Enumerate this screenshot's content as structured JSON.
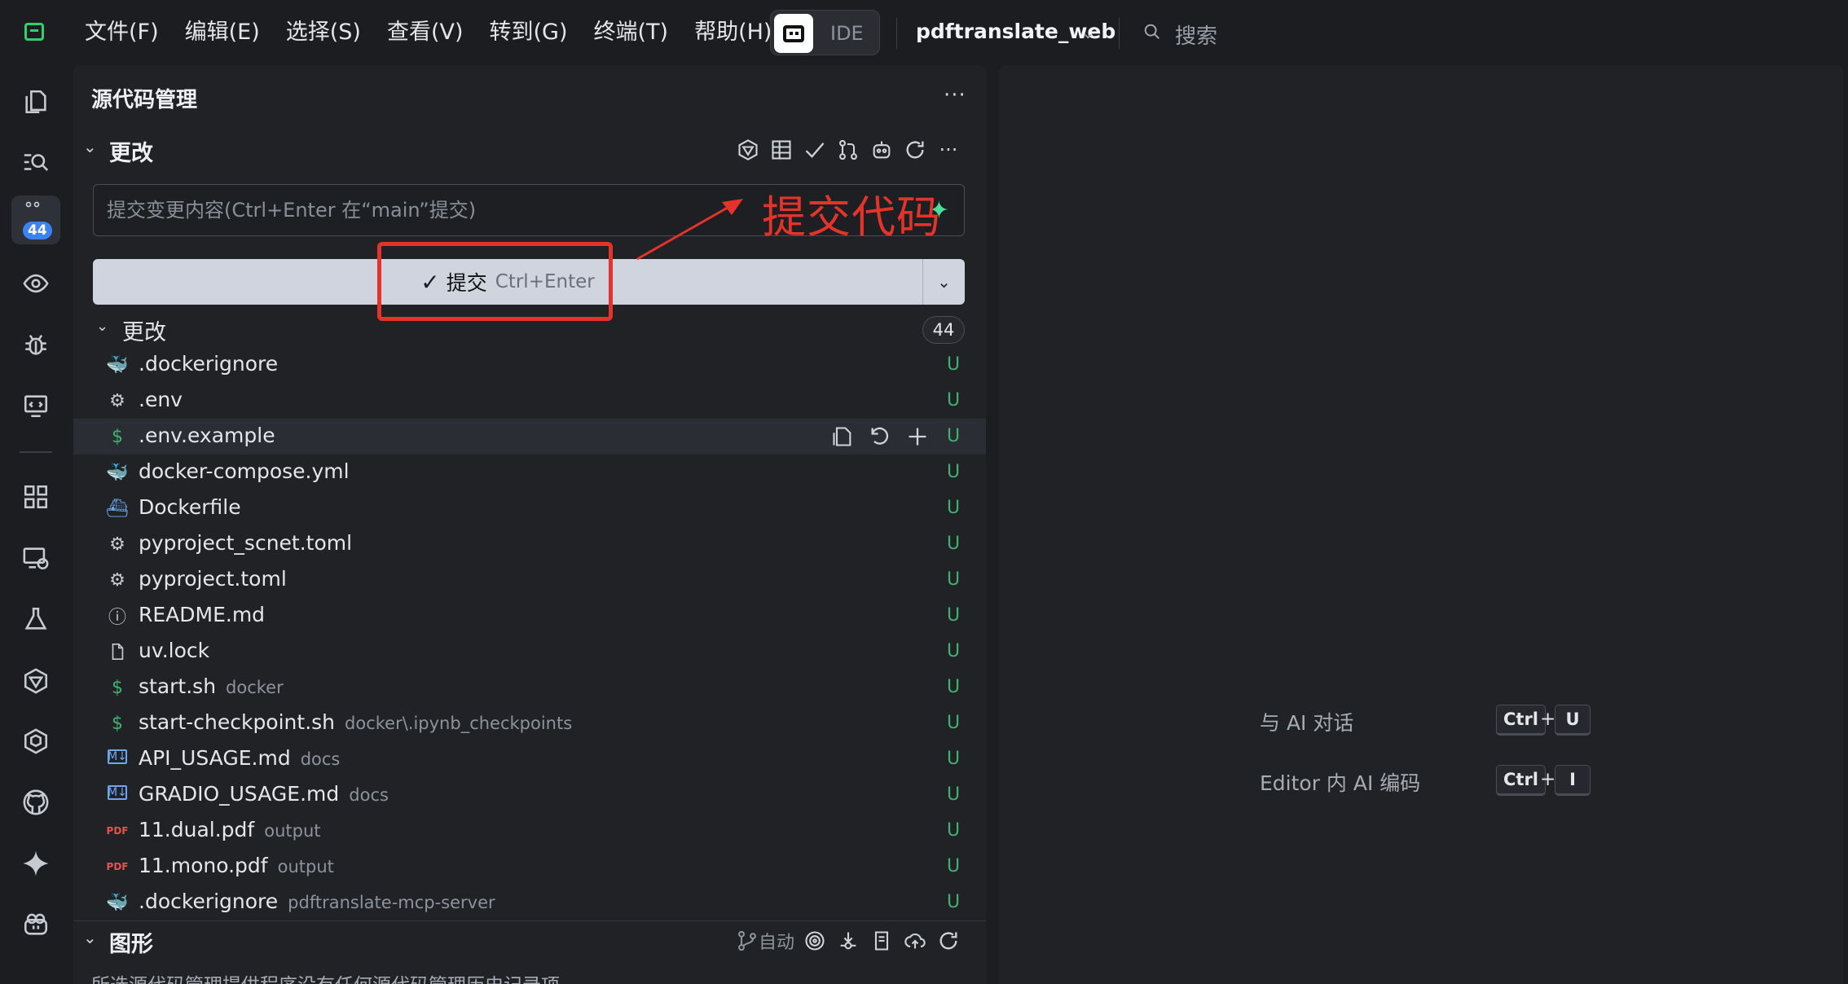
{
  "menu": [
    "文件(F)",
    "编辑(E)",
    "选择(S)",
    "查看(V)",
    "转到(G)",
    "终端(T)",
    "帮助(H)"
  ],
  "mode_toggle": {
    "label": "IDE"
  },
  "project": {
    "name": "pdftranslate_web"
  },
  "search": {
    "label": "搜索"
  },
  "activity": {
    "items": [
      "explorer-icon",
      "search-icon",
      "source-control-icon",
      "eye-icon",
      "debug-icon",
      "remote-icon",
      "extensions-icon",
      "remote-explorer-icon",
      "testing-icon",
      "ai-icon",
      "blocks-icon",
      "github-icon",
      "sparkle-icon",
      "copilot-icon"
    ],
    "scm_badge": "44"
  },
  "scm": {
    "title": "源代码管理",
    "more": "···",
    "changes_section": "更改",
    "commit_placeholder": "提交变更内容(Ctrl+Enter 在“main”提交)",
    "commit_button": {
      "label": "提交",
      "shortcut": "Ctrl+Enter"
    },
    "changes_group": {
      "title": "更改",
      "count": "44"
    },
    "files": [
      {
        "name": ".dockerignore",
        "dir": "",
        "status": "U",
        "icon": "docker-icon"
      },
      {
        "name": ".env",
        "dir": "",
        "status": "U",
        "icon": "gear-icon"
      },
      {
        "name": ".env.example",
        "dir": "",
        "status": "U",
        "icon": "dollar-icon"
      },
      {
        "name": "docker-compose.yml",
        "dir": "",
        "status": "U",
        "icon": "docker-icon"
      },
      {
        "name": "Dockerfile",
        "dir": "",
        "status": "U",
        "icon": "docker-file-icon"
      },
      {
        "name": "pyproject_scnet.toml",
        "dir": "",
        "status": "U",
        "icon": "gear-icon"
      },
      {
        "name": "pyproject.toml",
        "dir": "",
        "status": "U",
        "icon": "gear-icon"
      },
      {
        "name": "README.md",
        "dir": "",
        "status": "U",
        "icon": "info-icon"
      },
      {
        "name": "uv.lock",
        "dir": "",
        "status": "U",
        "icon": "file-icon"
      },
      {
        "name": "start.sh",
        "dir": "docker",
        "status": "U",
        "icon": "dollar-icon"
      },
      {
        "name": "start-checkpoint.sh",
        "dir": "docker\\.ipynb_checkpoints",
        "status": "U",
        "icon": "dollar-icon"
      },
      {
        "name": "API_USAGE.md",
        "dir": "docs",
        "status": "U",
        "icon": "markdown-icon"
      },
      {
        "name": "GRADIO_USAGE.md",
        "dir": "docs",
        "status": "U",
        "icon": "markdown-icon"
      },
      {
        "name": "11.dual.pdf",
        "dir": "output",
        "status": "U",
        "icon": "pdf-icon"
      },
      {
        "name": "11.mono.pdf",
        "dir": "output",
        "status": "U",
        "icon": "pdf-icon"
      },
      {
        "name": ".dockerignore",
        "dir": "pdftranslate-mcp-server",
        "status": "U",
        "icon": "docker-icon"
      }
    ],
    "graph_section": "图形",
    "graph_auto": "自动",
    "graph_empty": "所选源代码管理提供程序没有任何源代码管理历史记录项。"
  },
  "editor_hints": [
    {
      "label": "与 AI 对话",
      "keys": [
        "Ctrl",
        "U"
      ]
    },
    {
      "label": "Editor 内 AI 编码",
      "keys": [
        "Ctrl",
        "I"
      ]
    }
  ],
  "annotation": {
    "text": "提交代码"
  },
  "colors": {
    "accent_blue": "#3b82f6",
    "untracked_green": "#3fb36e",
    "annotation_red": "#e5332a",
    "brand_green": "#2fd16c"
  }
}
